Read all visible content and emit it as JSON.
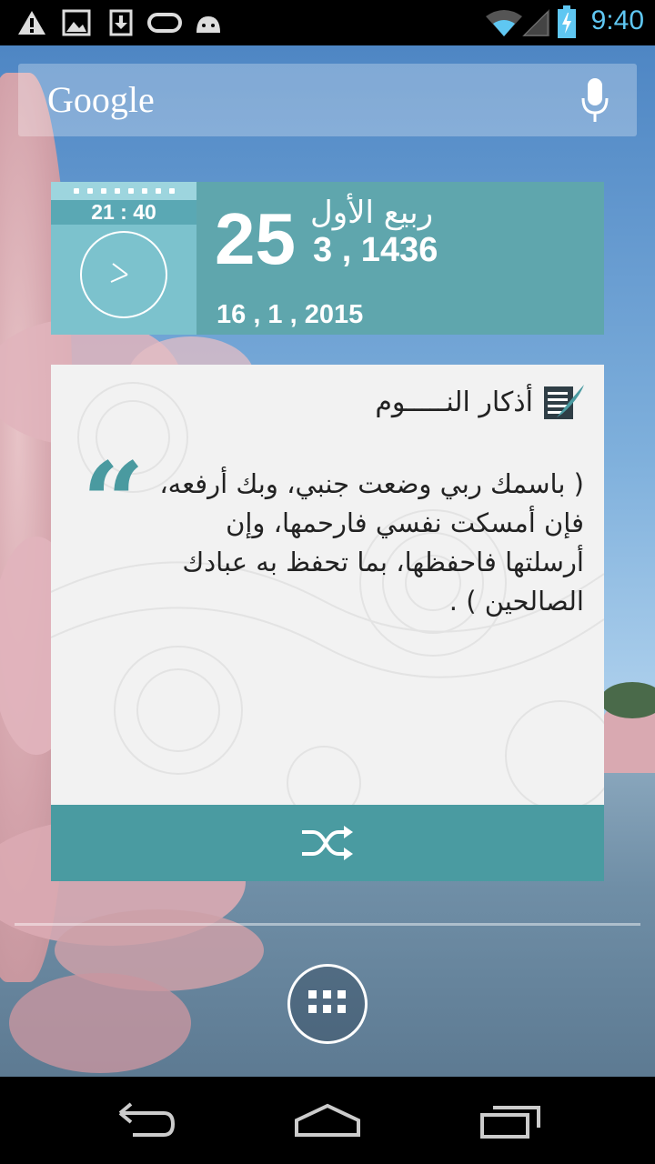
{
  "status_bar": {
    "time": "9:40",
    "icons": [
      "warning-icon",
      "image-icon",
      "download-icon",
      "gamepad-icon",
      "android-icon",
      "wifi-icon",
      "signal-icon",
      "battery-charging-icon"
    ]
  },
  "search_bar": {
    "logo_text": "Google",
    "icon": "mic-icon"
  },
  "date_widget": {
    "time": "21 : 40",
    "day": "25",
    "hijri_month": "ربيع الأول",
    "hijri_year": "3 , 1436",
    "gregorian_date": "16 , 1 , 2015"
  },
  "dhikr_card": {
    "title": "أذكار النـــــوم",
    "quote_mark": "“",
    "text": "( باسمك ربي وضعت جنبي، وبك أرفعه، فإن أمسكت نفسي فارحمها، وإن أرسلتها فاحفظها، بما تحفظ به عبادك الصالحين ) ."
  },
  "colors": {
    "teal_dark": "#4a9ba1",
    "teal_light": "#7cc2cd",
    "clock_accent": "#5fc7f2"
  }
}
